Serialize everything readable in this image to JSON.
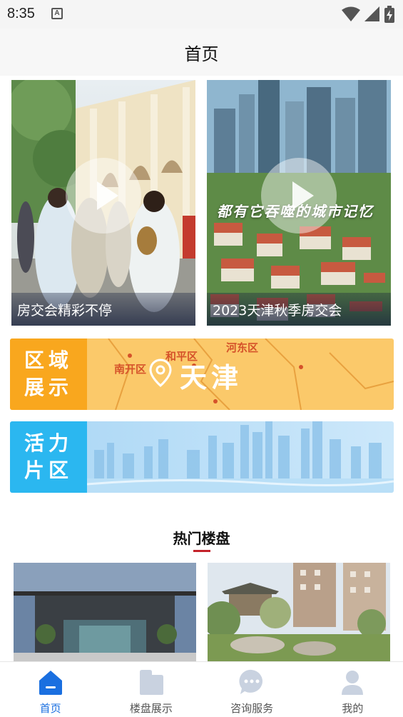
{
  "status_bar": {
    "time": "8:35",
    "notification_icon": "text-a-icon",
    "icons": [
      "wifi-icon",
      "signal-icon",
      "battery-charging-icon"
    ]
  },
  "header": {
    "title": "首页"
  },
  "videos": [
    {
      "caption": "房交会精彩不停",
      "icon": "play-icon"
    },
    {
      "caption": "2023天津秋季房交会",
      "overlay": "都有它吞噬的城市记忆",
      "icon": "play-icon"
    }
  ],
  "banners": {
    "district": {
      "label_line1": "区域",
      "label_line2": "展示",
      "city": "天津",
      "areas": [
        "南开区",
        "和平区",
        "河东区"
      ],
      "icon": "location-pin-icon"
    },
    "vitality": {
      "label_line1": "活力",
      "label_line2": "片区"
    }
  },
  "hot_properties": {
    "title": "热门楼盘"
  },
  "bottom_nav": [
    {
      "label": "首页",
      "icon": "home-icon",
      "active": true
    },
    {
      "label": "楼盘展示",
      "icon": "building-icon",
      "active": false
    },
    {
      "label": "咨询服务",
      "icon": "chat-icon",
      "active": false
    },
    {
      "label": "我的",
      "icon": "user-icon",
      "active": false
    }
  ],
  "colors": {
    "accent_blue": "#1a6fe0",
    "district_orange": "#f9a71e",
    "vitality_blue": "#2bb7f0",
    "underline_red": "#c4222a"
  }
}
